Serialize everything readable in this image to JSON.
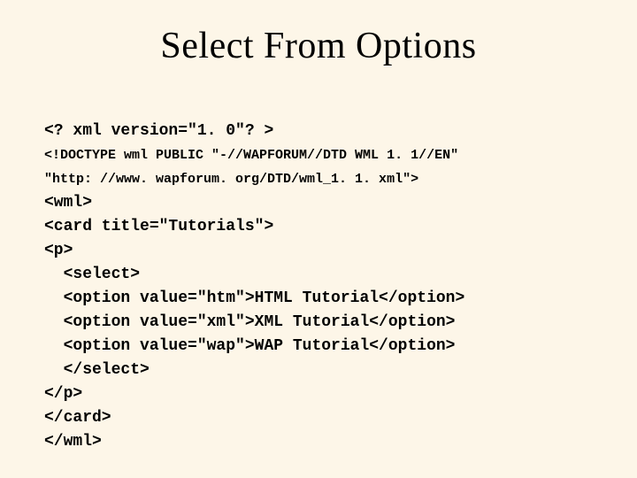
{
  "title": "Select From Options",
  "code": {
    "l1": "<? xml version=\"1. 0\"? >",
    "l2": "<!DOCTYPE wml PUBLIC \"-//WAPFORUM//DTD WML 1. 1//EN\"",
    "l3": "\"http: //www. wapforum. org/DTD/wml_1. 1. xml\">",
    "l4": "<wml>",
    "l5": "<card title=\"Tutorials\">",
    "l6": "<p>",
    "l7": "  <select>",
    "l8": "  <option value=\"htm\">HTML Tutorial</option>",
    "l9": "  <option value=\"xml\">XML Tutorial</option>",
    "l10": "  <option value=\"wap\">WAP Tutorial</option>",
    "l11": "  </select>",
    "l12": "</p>",
    "l13": "</card>",
    "l14": "</wml>"
  }
}
